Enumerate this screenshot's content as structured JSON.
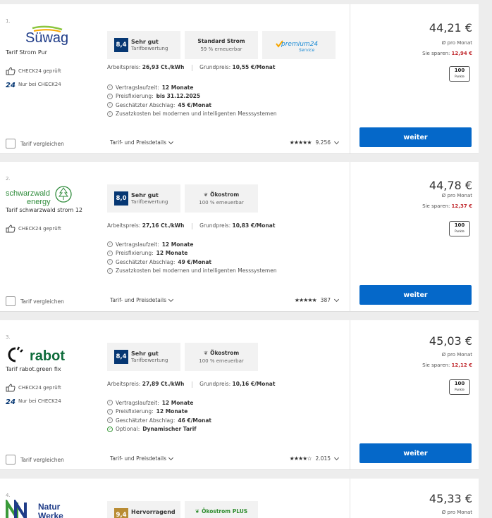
{
  "results": [
    {
      "rank": "1.",
      "logo_text": "Süwag",
      "tariff_name": "Tarif Strom Pur",
      "features": [
        "CHECK24 geprüft",
        "Nur bei CHECK24"
      ],
      "compare_label": "Tarif vergleichen",
      "score": "8,4",
      "score_label": "Sehr gut",
      "score_sub": "Tarifbewertung",
      "mix_title": "Standard Strom",
      "mix_sub": "59 % erneuerbar",
      "service_badge": "premium24",
      "service_badge_sub": "Service",
      "arbeitspreis_label": "Arbeitspreis:",
      "arbeitspreis": "26,93 Ct./kWh",
      "grundpreis_label": "Grundpreis:",
      "grundpreis": "10,55 €/Monat",
      "info": [
        {
          "label": "Vertragslaufzeit:",
          "value": "12 Monate"
        },
        {
          "label": "Preisfixierung:",
          "value": "bis 31.12.2025"
        },
        {
          "label": "Geschätzter Abschlag:",
          "value": "45 €/Monat"
        },
        {
          "label": "Zusatzkosten bei modernen und intelligenten Messsystemen",
          "value": ""
        }
      ],
      "details_label": "Tarif- und Preisdetails",
      "review_count": "9.256",
      "price": "44,21 €",
      "per_month": "Ø pro Monat",
      "savings_label": "Sie sparen:",
      "savings": "12,94 €",
      "points": "100",
      "points_sub": "Punkte",
      "cta": "weiter"
    },
    {
      "rank": "2.",
      "logo_text": "schwarzwald",
      "logo_text2": "energy",
      "tariff_name": "Tarif schwarzwald strom 12",
      "features": [
        "CHECK24 geprüft"
      ],
      "compare_label": "Tarif vergleichen",
      "score": "8,0",
      "score_label": "Sehr gut",
      "score_sub": "Tarifbewertung",
      "mix_title": "Ökostrom",
      "mix_sub": "100 % erneuerbar",
      "arbeitspreis_label": "Arbeitspreis:",
      "arbeitspreis": "27,16 Ct./kWh",
      "grundpreis_label": "Grundpreis:",
      "grundpreis": "10,83 €/Monat",
      "info": [
        {
          "label": "Vertragslaufzeit:",
          "value": "12 Monate"
        },
        {
          "label": "Preisfixierung:",
          "value": "12 Monate"
        },
        {
          "label": "Geschätzter Abschlag:",
          "value": "49 €/Monat"
        },
        {
          "label": "Zusatzkosten bei modernen und intelligenten Messsystemen",
          "value": ""
        }
      ],
      "details_label": "Tarif- und Preisdetails",
      "review_count": "387",
      "price": "44,78 €",
      "per_month": "Ø pro Monat",
      "savings_label": "Sie sparen:",
      "savings": "12,37 €",
      "points": "100",
      "points_sub": "Punkte",
      "cta": "weiter"
    },
    {
      "rank": "3.",
      "logo_text": "rabot",
      "tariff_name": "Tarif rabot.green fix",
      "features": [
        "CHECK24 geprüft",
        "Nur bei CHECK24"
      ],
      "compare_label": "Tarif vergleichen",
      "score": "8,4",
      "score_label": "Sehr gut",
      "score_sub": "Tarifbewertung",
      "mix_title": "Ökostrom",
      "mix_sub": "100 % erneuerbar",
      "arbeitspreis_label": "Arbeitspreis:",
      "arbeitspreis": "27,89 Ct./kWh",
      "grundpreis_label": "Grundpreis:",
      "grundpreis": "10,16 €/Monat",
      "info": [
        {
          "label": "Vertragslaufzeit:",
          "value": "12 Monate"
        },
        {
          "label": "Preisfixierung:",
          "value": "12 Monate"
        },
        {
          "label": "Geschätzter Abschlag:",
          "value": "46 €/Monat"
        },
        {
          "label": "Optional:",
          "value": "Dynamischer Tarif"
        }
      ],
      "details_label": "Tarif- und Preisdetails",
      "review_count": "2.015",
      "price": "45,03 €",
      "per_month": "Ø pro Monat",
      "savings_label": "Sie sparen:",
      "savings": "12,12 €",
      "points": "100",
      "points_sub": "Punkte",
      "cta": "weiter"
    },
    {
      "rank": "4.",
      "logo_text": "Natur",
      "logo_text2": "Werke",
      "score": "9,4",
      "score_label": "Hervorragend",
      "mix_title": "Ökostrom PLUS",
      "price": "45,33 €",
      "per_month": "Ø pro Monat"
    }
  ]
}
